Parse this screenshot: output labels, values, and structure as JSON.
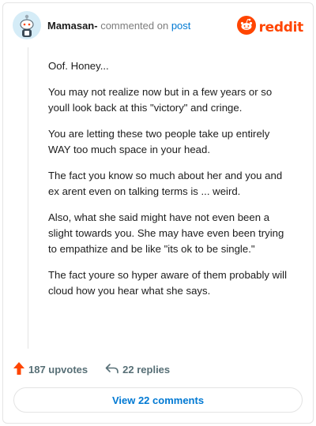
{
  "header": {
    "username": "Mamasan-",
    "commented_on": "commented on",
    "post_label": "post",
    "logo_text": "reddit",
    "avatar_icon": "snoo-avatar-icon",
    "logo_icon": "reddit-snoo-icon"
  },
  "comment": {
    "paragraphs": [
      "Oof. Honey...",
      "You may not realize now but in a few years or so youll look back at this \"victory\" and cringe.",
      "You are letting these two people take up entirely WAY too much space in your head.",
      "The fact you know so much about her and you and ex arent even on talking terms is ... weird.",
      "Also, what she said might have not even been a slight towards you. She may have even been trying to empathize and be like \"its ok to be single.\"",
      "The fact youre so hyper aware of them probably will cloud how you hear what she says."
    ]
  },
  "footer": {
    "upvotes": "187 upvotes",
    "replies": "22 replies",
    "upvote_icon": "upvote-arrow-icon",
    "reply_icon": "reply-arrow-icon"
  },
  "view_comments_label": "View 22 comments",
  "colors": {
    "brand": "#ff4500",
    "link": "#0079d3",
    "meta": "#7c7c7c"
  }
}
